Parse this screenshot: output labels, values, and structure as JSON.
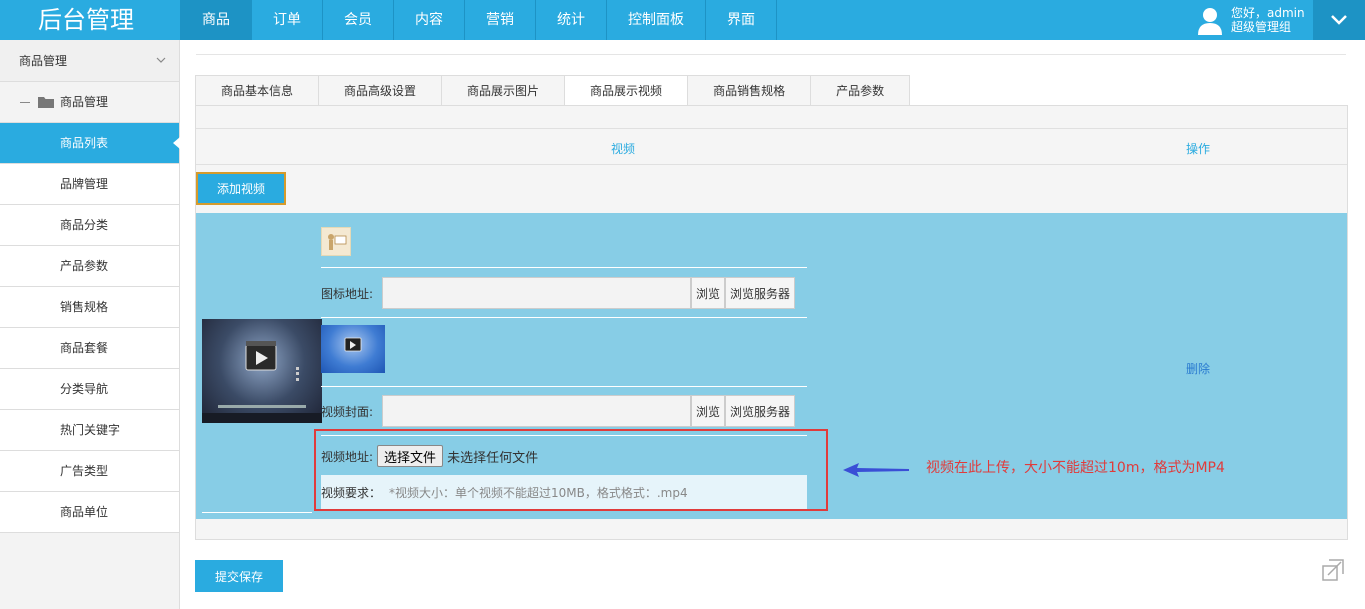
{
  "brand": "后台管理",
  "nav": [
    "商品",
    "订单",
    "会员",
    "内容",
    "营销",
    "统计",
    "控制面板",
    "界面"
  ],
  "user": {
    "greeting": "您好，admin",
    "role": "超级管理组"
  },
  "sidebar": {
    "header": "商品管理",
    "group": "商品管理",
    "items": [
      "商品列表",
      "品牌管理",
      "商品分类",
      "产品参数",
      "销售规格",
      "商品套餐",
      "分类导航",
      "热门关键字",
      "广告类型",
      "商品单位"
    ]
  },
  "tabs": [
    "商品基本信息",
    "商品高级设置",
    "商品展示图片",
    "商品展示视频",
    "商品销售规格",
    "产品参数"
  ],
  "table": {
    "col_video": "视频",
    "col_op": "操作"
  },
  "add_video_label": "添加视频",
  "form": {
    "icon_label": "图标地址:",
    "cover_label": "视频封面:",
    "browse": "浏览",
    "browse_server": "浏览服务器",
    "url_label": "视频地址:",
    "choose_file": "选择文件",
    "no_file": "未选择任何文件",
    "req_label": "视频要求：",
    "req_text": "*视频大小：单个视频不能超过10MB，格式格式：.mp4"
  },
  "delete_label": "删除",
  "submit_label": "提交保存",
  "annotation": "视频在此上传，大小不能超过10m，格式为MP4",
  "colors": {
    "primary": "#2aabe0",
    "row_bg": "#87cde6",
    "annotation": "#e03b3b",
    "link": "#2a7bd0"
  }
}
